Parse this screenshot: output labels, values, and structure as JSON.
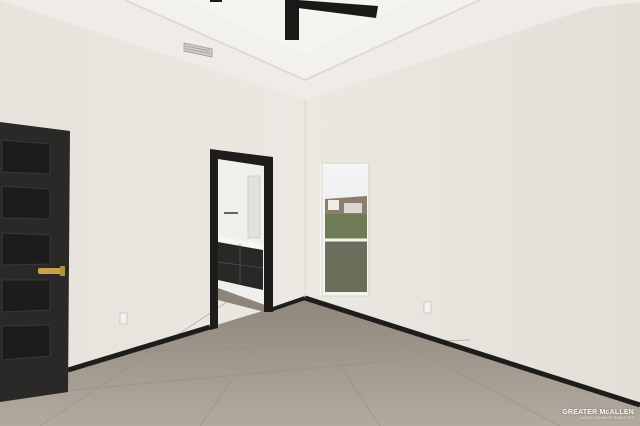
{
  "scene": {
    "subject": "empty-bedroom-interior",
    "colors": {
      "wall": "#e8e4de",
      "ceiling": "#efece7",
      "trim": "#1f1d1c",
      "door": "#2b2928",
      "floor": "#a39a8e",
      "handle": "#c8a24a"
    }
  },
  "watermark": {
    "main_text": "GREATER McALLEN",
    "sub_text": "ASSOCIATION OF REALTORS"
  }
}
